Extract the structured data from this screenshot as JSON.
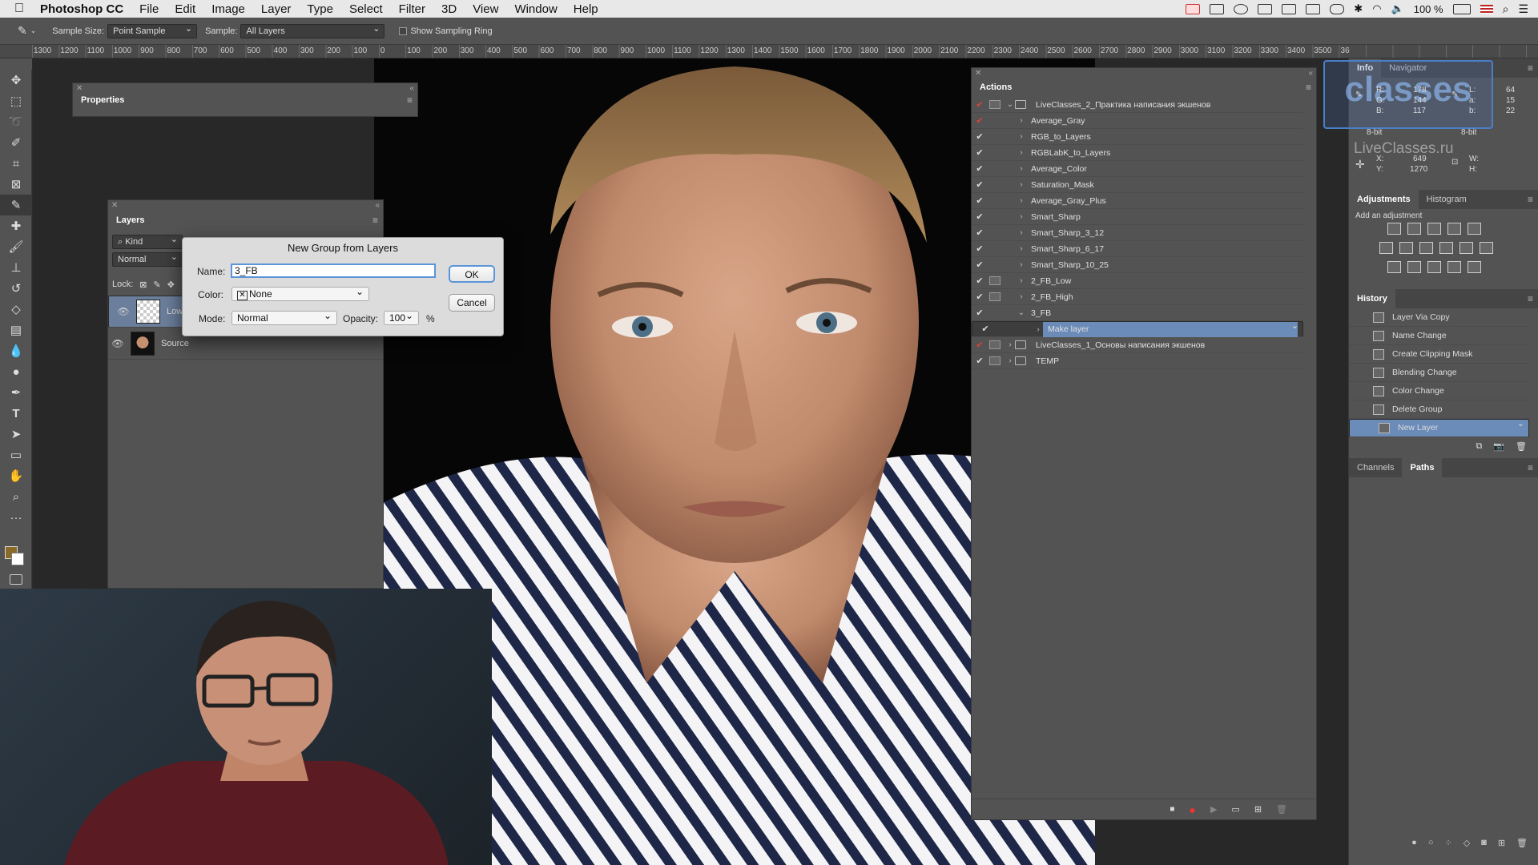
{
  "menubar": {
    "app_name": "Photoshop CC",
    "items": [
      "File",
      "Edit",
      "Image",
      "Layer",
      "Type",
      "Select",
      "Filter",
      "3D",
      "View",
      "Window",
      "Help"
    ],
    "battery": "100 %"
  },
  "options": {
    "sample_size_label": "Sample Size:",
    "sample_size_value": "Point Sample",
    "sample_label": "Sample:",
    "sample_value": "All Layers",
    "sampling_ring_label": "Show Sampling Ring"
  },
  "ruler": [
    "1300",
    "1200",
    "1100",
    "1000",
    "900",
    "800",
    "700",
    "600",
    "500",
    "400",
    "300",
    "200",
    "100",
    "0",
    "100",
    "200",
    "300",
    "400",
    "500",
    "600",
    "700",
    "800",
    "900",
    "1000",
    "1100",
    "1200",
    "1300",
    "1400",
    "1500",
    "1600",
    "1700",
    "1800",
    "1900",
    "2000",
    "2100",
    "2200",
    "2300",
    "2400",
    "2500",
    "2600",
    "2700",
    "2800",
    "2900",
    "3000",
    "3100",
    "3200",
    "3300",
    "3400",
    "3500",
    "36"
  ],
  "properties": {
    "title": "Properties"
  },
  "layers": {
    "title": "Layers",
    "kind": "Kind",
    "blend": "Normal",
    "lock_label": "Lock:",
    "rows": [
      {
        "name": "Low",
        "selected": true
      },
      {
        "name": "Source",
        "selected": false
      }
    ]
  },
  "dialog": {
    "title": "New Group from Layers",
    "name_label": "Name:",
    "name_value": "3_FB",
    "color_label": "Color:",
    "color_value": "None",
    "mode_label": "Mode:",
    "mode_value": "Normal",
    "opacity_label": "Opacity:",
    "opacity_value": "100",
    "percent": "%",
    "ok": "OK",
    "cancel": "Cancel"
  },
  "actions": {
    "title": "Actions",
    "rows": [
      {
        "name": "LiveClasses_2_Практика написания экшенов",
        "level": 0,
        "folder": true,
        "expanded": true,
        "red": true,
        "dialog": true
      },
      {
        "name": "Average_Gray",
        "level": 1,
        "red": true
      },
      {
        "name": "RGB_to_Layers",
        "level": 1
      },
      {
        "name": "RGBLabK_to_Layers",
        "level": 1
      },
      {
        "name": "Average_Color",
        "level": 1
      },
      {
        "name": "Saturation_Mask",
        "level": 1
      },
      {
        "name": "Average_Gray_Plus",
        "level": 1
      },
      {
        "name": "Smart_Sharp",
        "level": 1
      },
      {
        "name": "Smart_Sharp_3_12",
        "level": 1
      },
      {
        "name": "Smart_Sharp_6_17",
        "level": 1
      },
      {
        "name": "Smart_Sharp_10_25",
        "level": 1
      },
      {
        "name": "2_FB_Low",
        "level": 1,
        "dialog": true
      },
      {
        "name": "2_FB_High",
        "level": 1,
        "dialog": true
      },
      {
        "name": "3_FB",
        "level": 1,
        "expanded": true
      },
      {
        "name": "Make layer",
        "level": 2,
        "selected": true
      },
      {
        "name": "LiveClasses_1_Основы написания экшенов",
        "level": 0,
        "folder": true,
        "red": true,
        "dialog": true
      },
      {
        "name": "TEMP",
        "level": 0,
        "folder": true,
        "dialog": true
      }
    ]
  },
  "info": {
    "tabs": [
      "Info",
      "Navigator"
    ],
    "r": "R:",
    "r_val": "178",
    "g": "G:",
    "g_val": "144",
    "b": "B:",
    "b_val": "117",
    "l": "L:",
    "l_val": "64",
    "a": "a:",
    "a_val": "15",
    "bb": "b:",
    "bb_val": "22",
    "bit1": "8-bit",
    "bit2": "8-bit",
    "x": "X:",
    "x_val": "649",
    "y": "Y:",
    "y_val": "1270",
    "w": "W:",
    "h": "H:",
    "watermark": "classes",
    "watermark_url": "LiveClasses.ru"
  },
  "adjustments": {
    "tabs": [
      "Adjustments",
      "Histogram"
    ],
    "hint": "Add an adjustment"
  },
  "history": {
    "title": "History",
    "rows": [
      {
        "name": "Layer Via Copy",
        "selected": false
      },
      {
        "name": "Name Change",
        "selected": false
      },
      {
        "name": "Create Clipping Mask",
        "selected": false
      },
      {
        "name": "Blending Change",
        "selected": false
      },
      {
        "name": "Color Change",
        "selected": false
      },
      {
        "name": "Delete Group",
        "selected": false
      },
      {
        "name": "New Layer",
        "selected": true
      }
    ]
  },
  "channels": {
    "tabs": [
      "Channels",
      "Paths"
    ]
  },
  "colors": {
    "accent": "#6b8bb8",
    "panel": "#535353",
    "fg_swatch": "#8a6a28"
  }
}
